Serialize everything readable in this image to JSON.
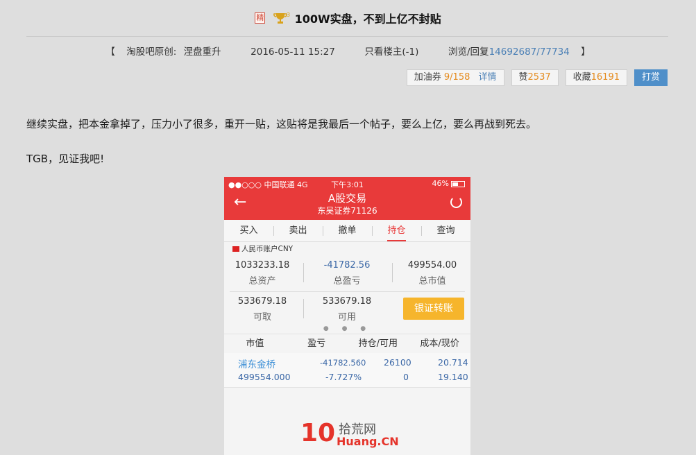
{
  "post": {
    "jing": "精",
    "trophy_level": "3",
    "title": "100W实盘，不到上亿不封贴"
  },
  "meta": {
    "bracket_open": "【",
    "source_label": "淘股吧原创:",
    "author": "涅盘重升",
    "date": "2016-05-11 15:27",
    "only_author": "只看楼主(-1)",
    "stats_label": "浏览/回复",
    "views": "14692687",
    "slash": "/",
    "replies": "77734",
    "bracket_close": "】"
  },
  "actions": {
    "fuel_label": "加油券",
    "fuel_value": "9/158",
    "detail": "详情",
    "like_label": "赞",
    "like_value": "2537",
    "fav_label": "收藏",
    "fav_value": "16191",
    "reward": "打赏"
  },
  "content": {
    "p1": "继续实盘，把本金拿掉了，压力小了很多，重开一贴，这贴将是我最后一个帖子，要么上亿，要么再战到死去。",
    "p2": "TGB，见证我吧!"
  },
  "phone": {
    "carrier": "●●○○○ 中国联通  4G",
    "time": "下午3:01",
    "battery": "46%",
    "title": "A股交易",
    "subtitle": "东吴证券71126",
    "tabs": [
      "买入",
      "卖出",
      "撤单",
      "持仓",
      "查询"
    ],
    "active_tab": "持仓",
    "account": "人民币账户CNY",
    "total_assets": "1033233.18",
    "total_assets_label": "总资产",
    "total_pl": "-41782.56",
    "total_pl_label": "总盈亏",
    "market_value": "499554.00",
    "market_value_label": "总市值",
    "withdrawable": "533679.18",
    "withdrawable_label": "可取",
    "available": "533679.18",
    "available_label": "可用",
    "transfer_button": "银证转账",
    "pager": "● ● ●",
    "table_headers": [
      "市值",
      "盈亏",
      "持仓/可用",
      "成本/现价"
    ],
    "holding": {
      "name": "浦东金桥",
      "market_value": "499554.000",
      "pl": "-41782.560",
      "pl_pct": "-7.727%",
      "position": "26100",
      "available": "0",
      "cost": "20.714",
      "price": "19.140"
    }
  },
  "watermark": {
    "num": "10",
    "cn": "拾荒网",
    "en": "Huang.CN"
  }
}
